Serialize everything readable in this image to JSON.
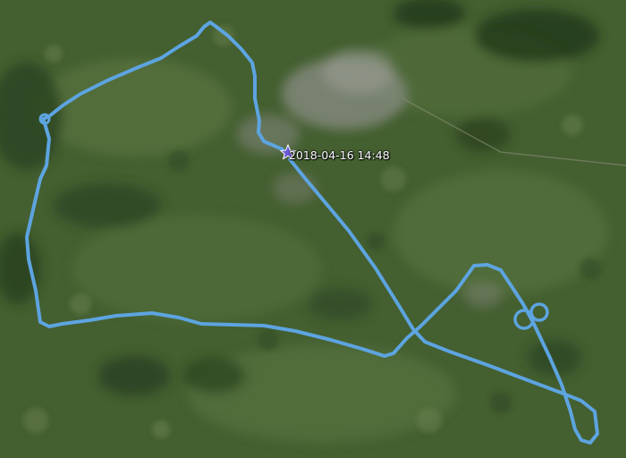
{
  "map": {
    "view": "satellite",
    "track_color": "#5da4e0",
    "marker": {
      "icon": "placemark-star-icon",
      "label": "2018-04-16 14:48"
    }
  }
}
